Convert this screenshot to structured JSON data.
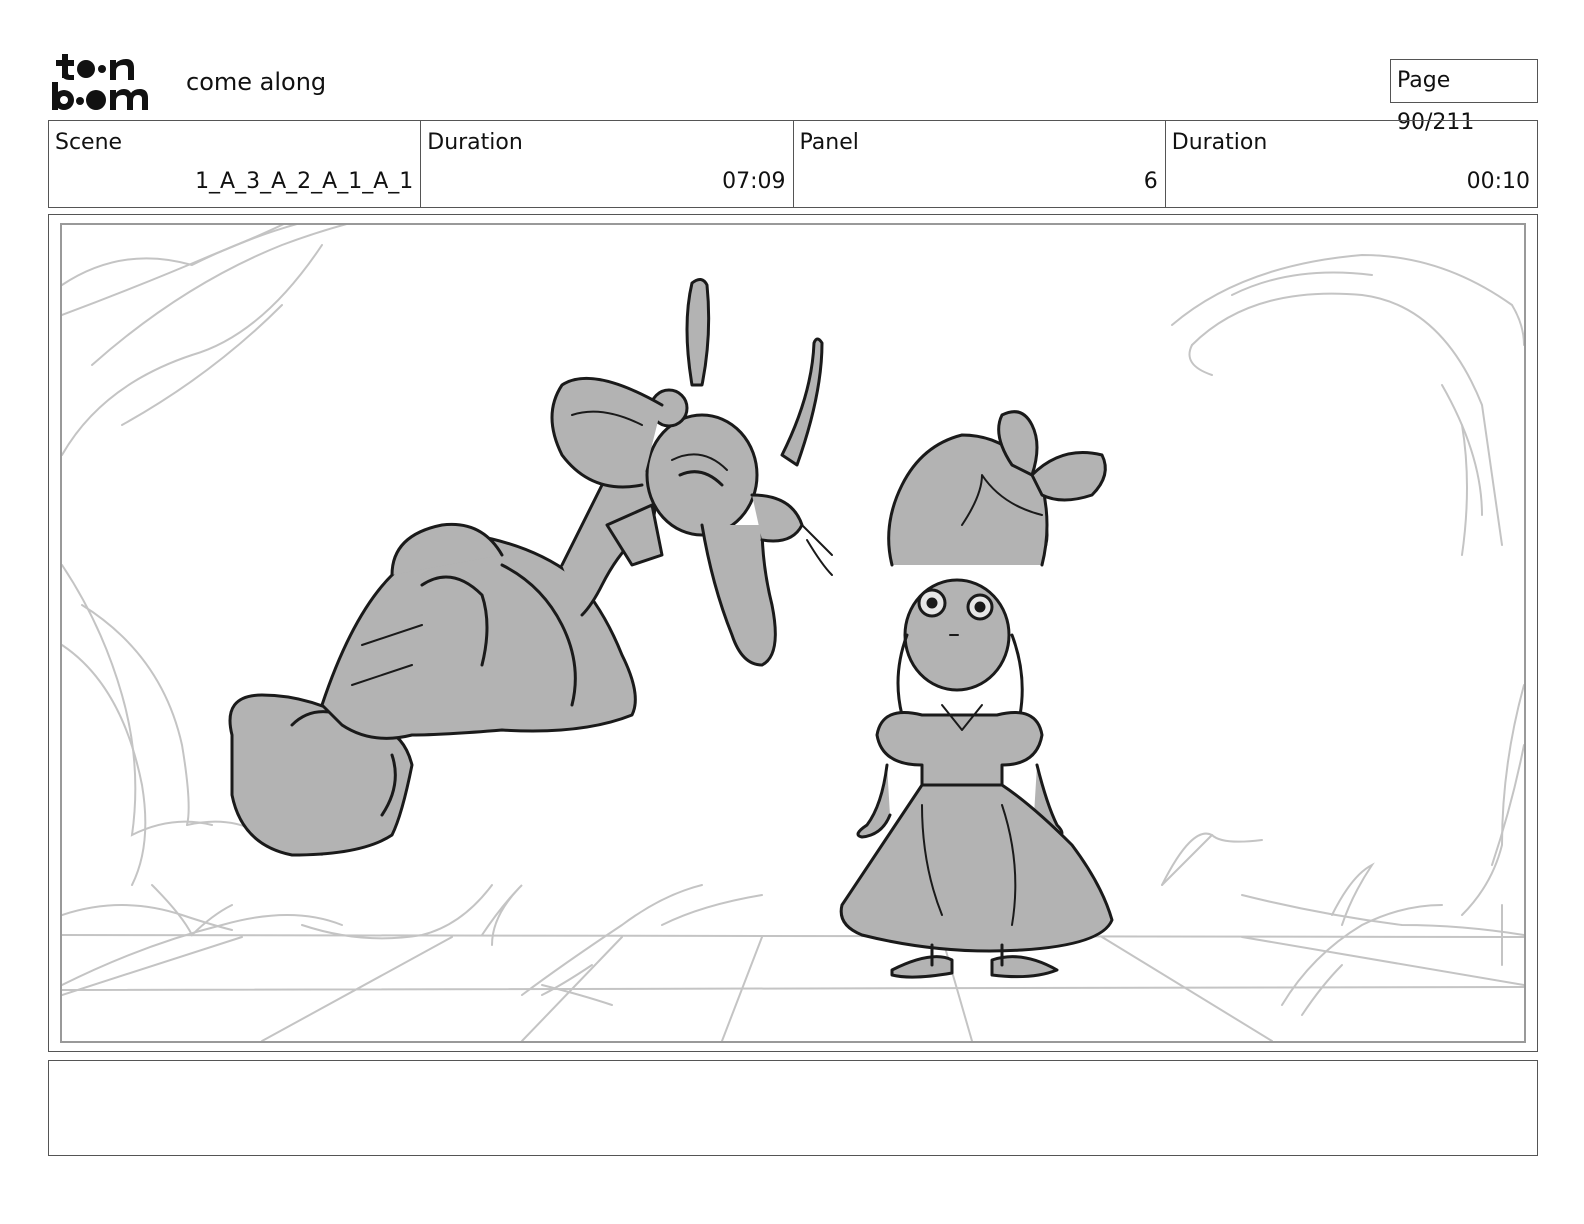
{
  "header": {
    "logo_text": "toon boom",
    "project_title": "come along",
    "page_label": "Page",
    "page_value": "90/211"
  },
  "info": {
    "scene_label": "Scene",
    "scene_value": "1_A_3_A_2_A_1_A_1",
    "scene_duration_label": "Duration",
    "scene_duration_value": "07:09",
    "panel_label": "Panel",
    "panel_value": "6",
    "panel_duration_label": "Duration",
    "panel_duration_value": "00:10"
  },
  "panel": {
    "description": ""
  },
  "notes": {
    "text": ""
  },
  "colors": {
    "sketch_fill": "#b3b3b3",
    "sketch_line": "#1a1a1a",
    "background_line": "#c4c4c4",
    "border": "#555555"
  }
}
